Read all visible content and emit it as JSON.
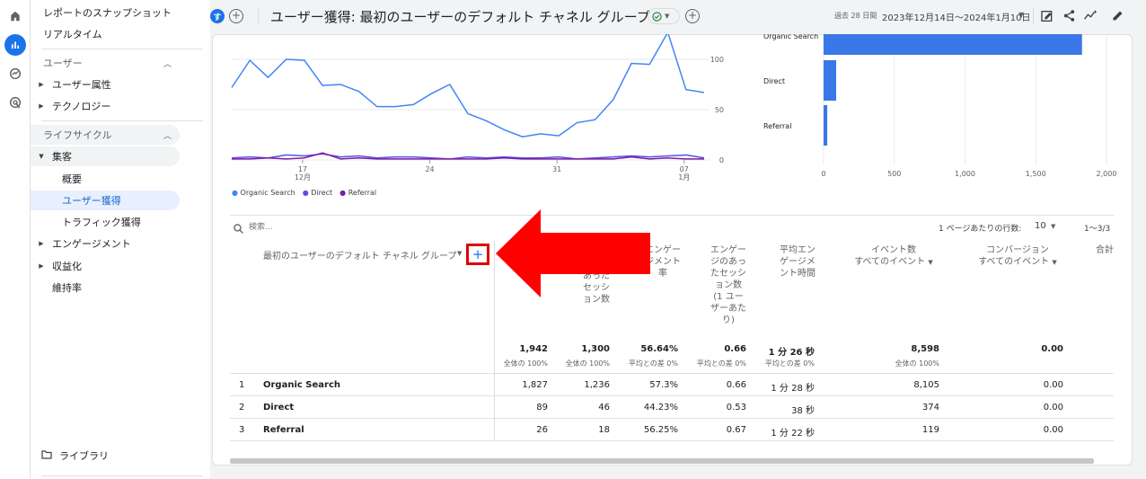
{
  "sidebar": {
    "snapshot": "レポートのスナップショット",
    "realtime": "リアルタイム",
    "section_user": "ユーザー",
    "user_attr": "ユーザー属性",
    "technology": "テクノロジー",
    "section_lifecycle": "ライフサイクル",
    "acquisition": "集客",
    "overview": "概要",
    "user_acq": "ユーザー獲得",
    "traffic_acq": "トラフィック獲得",
    "engagement": "エンゲージメント",
    "monetization": "収益化",
    "retention": "維持率",
    "library": "ライブラリ"
  },
  "header": {
    "avatar": "す",
    "title": "ユーザー獲得: 最初のユーザーのデフォルト チャネル グループ",
    "date_prefix": "過去 28 日間",
    "date_range": "2023年12月14日～2024年1月10日"
  },
  "colors": {
    "organic": "#4285f4",
    "direct": "#5b4ee8",
    "referral": "#7b1fa2",
    "bar": "#3b78e7",
    "arrow": "#ff0000"
  },
  "chart_data": [
    {
      "type": "line",
      "x_tick_labels": [
        "17",
        "24",
        "31",
        "07"
      ],
      "x_tick_sublabels": [
        "12月",
        "",
        "",
        "1月"
      ],
      "y_tick_labels": [
        "0",
        "50",
        "100"
      ],
      "y_ticks": [
        0,
        50,
        100
      ],
      "ylim": [
        0,
        125
      ],
      "series": [
        {
          "name": "Organic Search",
          "color": "#4285f4",
          "values": [
            72,
            99,
            82,
            100,
            99,
            74,
            75,
            68,
            53,
            53,
            55,
            66,
            75,
            46,
            39,
            30,
            23,
            26,
            24,
            37,
            40,
            60,
            96,
            95,
            130,
            70,
            67
          ]
        },
        {
          "name": "Direct",
          "color": "#5b4ee8",
          "values": [
            2,
            3,
            2,
            5,
            4,
            6,
            3,
            4,
            2,
            3,
            3,
            2,
            1,
            3,
            2,
            3,
            2,
            2,
            3,
            1,
            2,
            3,
            4,
            3,
            4,
            5,
            2
          ]
        },
        {
          "name": "Referral",
          "color": "#7b1fa2",
          "values": [
            1,
            1,
            2,
            1,
            2,
            7,
            1,
            2,
            1,
            1,
            1,
            1,
            1,
            1,
            1,
            2,
            1,
            1,
            1,
            1,
            1,
            1,
            3,
            1,
            2,
            1,
            1
          ]
        }
      ],
      "legend_position": "bottom-left"
    },
    {
      "type": "bar",
      "orientation": "horizontal",
      "categories": [
        "Organic Search",
        "Direct",
        "Referral"
      ],
      "values": [
        1827,
        89,
        26
      ],
      "x_tick_labels": [
        "0",
        "500",
        "1,000",
        "1,500",
        "2,000"
      ],
      "xlim": [
        0,
        2000
      ]
    }
  ],
  "table": {
    "search_placeholder": "検索...",
    "rows_per_page_label": "1 ページあたりの行数:",
    "rows_per_page": "10",
    "pagination": "1〜3/3",
    "dim_header": "最初のユーザーのデフォルト チャネル グループ",
    "add_dim": "+",
    "col_sessions_part": "あった\nセッシ\nョン数",
    "col_eng_rate_part": "エンゲー\nジメント\n率",
    "col_eng_sessions_per_user": "エンゲー\nジのあっ\nたセッシ\nョン数\n(1 ユー\nザーあた\nり)",
    "col_avg_time": "平均エン\nゲージメ\nント時間",
    "col_events": "イベント数",
    "col_events_sub": "すべてのイベント",
    "col_conv": "コンバージョン",
    "col_conv_sub": "すべてのイベント",
    "col_total": "合計",
    "totals": {
      "users": "1,942",
      "users_sub": "全体の 100%",
      "sessions": "1,300",
      "sessions_sub": "全体の 100%",
      "eng_rate": "56.64%",
      "eng_rate_sub": "平均との差 0%",
      "eng_per_user": "0.66",
      "eng_per_user_sub": "平均との差 0%",
      "avg_time": "1 分 26 秒",
      "avg_time_sub": "平均との差 0%",
      "events": "8,598",
      "events_sub": "全体の 100%",
      "conv": "0.00"
    },
    "rows": [
      {
        "idx": "1",
        "name": "Organic Search",
        "users": "1,827",
        "sessions": "1,236",
        "eng_rate": "57.3%",
        "eng_per_user": "0.66",
        "avg_time": "1 分 28 秒",
        "events": "8,105",
        "conv": "0.00"
      },
      {
        "idx": "2",
        "name": "Direct",
        "users": "89",
        "sessions": "46",
        "eng_rate": "44.23%",
        "eng_per_user": "0.53",
        "avg_time": "38 秒",
        "events": "374",
        "conv": "0.00"
      },
      {
        "idx": "3",
        "name": "Referral",
        "users": "26",
        "sessions": "18",
        "eng_rate": "56.25%",
        "eng_per_user": "0.67",
        "avg_time": "1 分 22 秒",
        "events": "119",
        "conv": "0.00"
      }
    ]
  }
}
